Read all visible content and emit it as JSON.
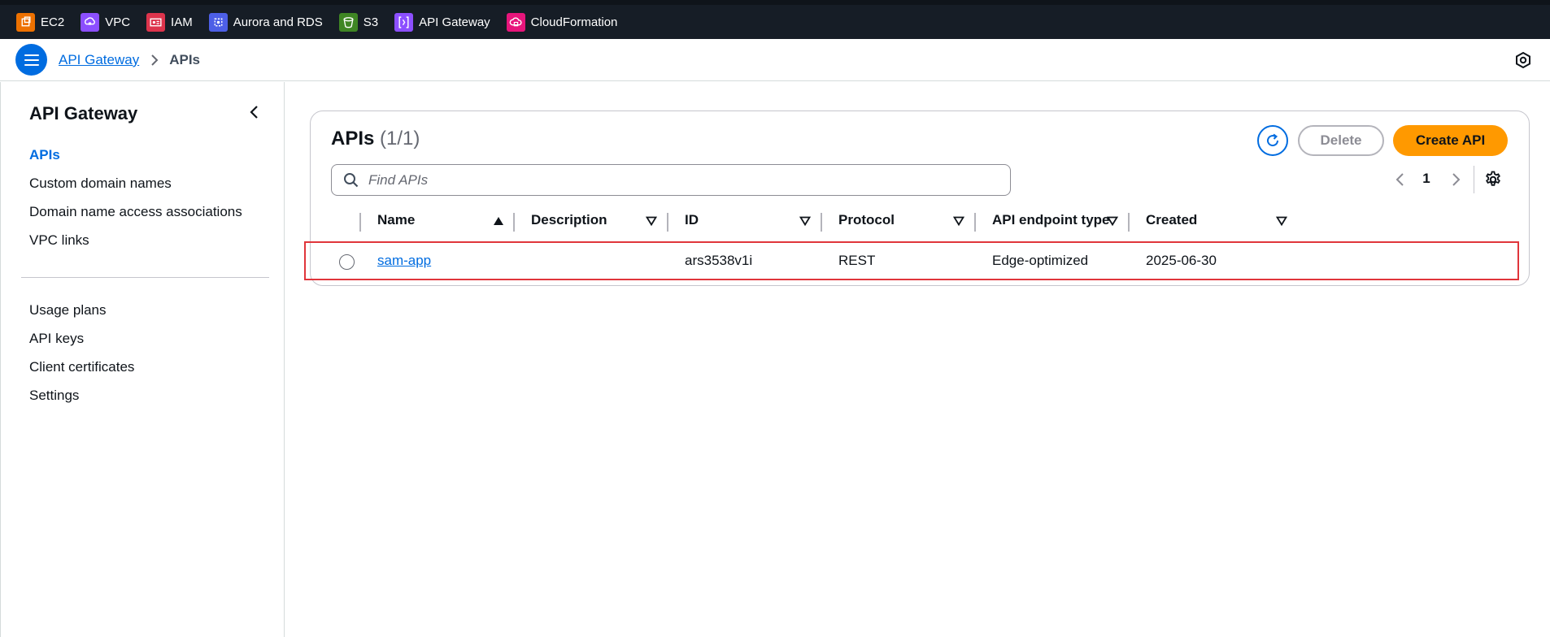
{
  "services": [
    {
      "label": "EC2",
      "icon": "ec2-icon",
      "color": "#ed7100"
    },
    {
      "label": "VPC",
      "icon": "vpc-icon",
      "color": "#8c4fff"
    },
    {
      "label": "IAM",
      "icon": "iam-icon",
      "color": "#dd344c"
    },
    {
      "label": "Aurora and RDS",
      "icon": "aurora-rds-icon",
      "color": "#4d5fe6"
    },
    {
      "label": "S3",
      "icon": "s3-icon",
      "color": "#3f8624"
    },
    {
      "label": "API Gateway",
      "icon": "api-gateway-icon",
      "color": "#8c4fff"
    },
    {
      "label": "CloudFormation",
      "icon": "cloudformation-icon",
      "color": "#e7157b"
    }
  ],
  "breadcrumb": {
    "root": "API Gateway",
    "current": "APIs"
  },
  "sidebar": {
    "title": "API Gateway",
    "items": [
      {
        "label": "APIs",
        "active": true
      },
      {
        "label": "Custom domain names"
      },
      {
        "label": "Domain name access associations"
      },
      {
        "label": "VPC links"
      },
      {
        "label": "Usage plans"
      },
      {
        "label": "API keys"
      },
      {
        "label": "Client certificates"
      },
      {
        "label": "Settings"
      }
    ]
  },
  "panel": {
    "title": "APIs",
    "count": "(1/1)",
    "delete_label": "Delete",
    "create_label": "Create API",
    "search_placeholder": "Find APIs",
    "page": "1"
  },
  "table": {
    "columns": [
      "Name",
      "Description",
      "ID",
      "Protocol",
      "API endpoint type",
      "Created"
    ],
    "rows": [
      {
        "name": "sam-app",
        "description": "",
        "id": "ars3538v1i",
        "protocol": "REST",
        "endpoint_type": "Edge-optimized",
        "created": "2025-06-30"
      }
    ]
  },
  "colors": {
    "accent": "#006ce0",
    "primary_button": "#ff9900",
    "topbar": "#161d26",
    "highlight": "#e0353b"
  }
}
